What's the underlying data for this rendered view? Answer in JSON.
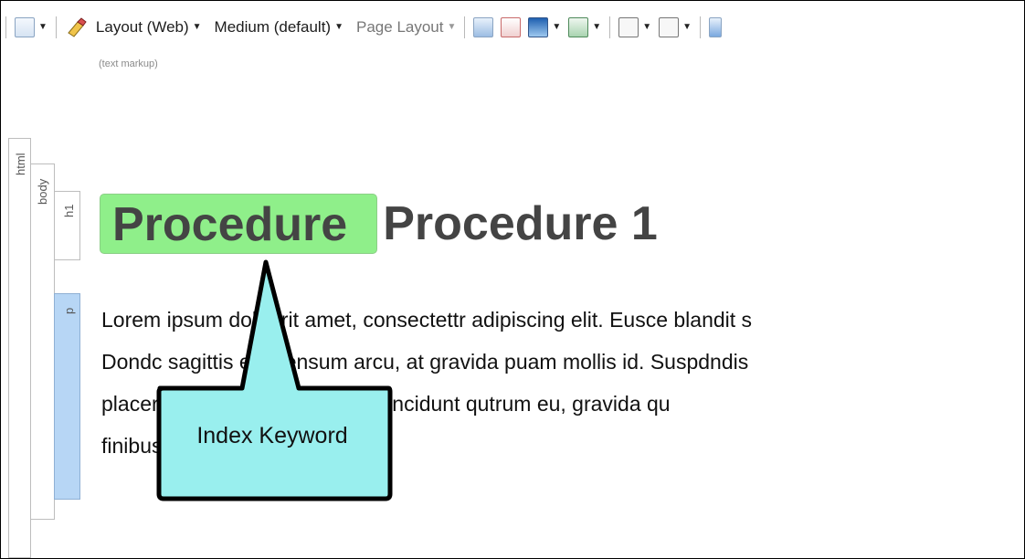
{
  "toolbar": {
    "layout_label": "Layout (Web)",
    "medium_label": "Medium (default)",
    "page_layout_label": "Page Layout",
    "hint": "(text markup)"
  },
  "structure_bars": {
    "html": "html",
    "body": "body",
    "h1": "h1",
    "p": "p"
  },
  "document": {
    "keyword_text": "Procedure",
    "heading_rest": "Procedure 1",
    "paragraph_lines": [
      "Lorem ipsum dolor rit amet, consectettr adipiscing elit. Eusce blandit s",
      "Dondc sagittis elemensum arcu, at gravida puam mollis id. Suspdndis",
      "placerat metus maurir, ornare tincidunt qutrum eu, gravida qu",
      "finibus."
    ]
  },
  "callout": {
    "label": "Index Keyword",
    "fill": "#99efee"
  },
  "colors": {
    "keyword_highlight": "#8fef8a",
    "p_bar": "#b7d6f5"
  }
}
